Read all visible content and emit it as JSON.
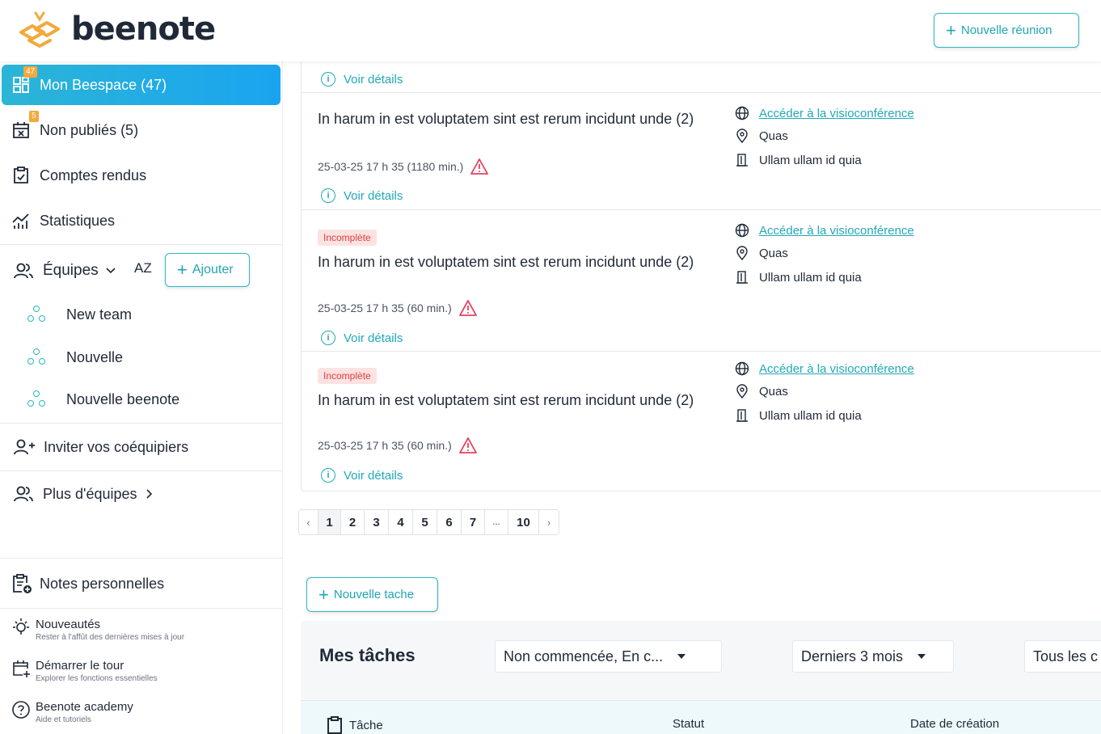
{
  "header": {
    "logo_text": "beenote",
    "new_meeting_label": "Nouvelle réunion"
  },
  "sidebar": {
    "items": [
      {
        "label": "Mon Beespace (47)",
        "badge": "47",
        "active": true
      },
      {
        "label": "Non publiés (5)",
        "badge": "5"
      },
      {
        "label": "Comptes rendus"
      },
      {
        "label": "Statistiques"
      }
    ],
    "teams": {
      "label": "Équipes",
      "sort_label": "AZ",
      "add_label": "Ajouter",
      "list": [
        "New team",
        "Nouvelle",
        "Nouvelle beenote"
      ]
    },
    "invite_label": "Inviter vos coéquipiers",
    "more_teams_label": "Plus d'équipes",
    "notes_label": "Notes personnelles",
    "bottom": [
      {
        "title": "Nouveautés",
        "sub": "Rester à l'affût des dernières mises à jour"
      },
      {
        "title": "Démarrer le tour",
        "sub": "Explorer les fonctions essentielles"
      },
      {
        "title": "Beenote academy",
        "sub": "Aide et tutoriels"
      }
    ]
  },
  "meetings": {
    "details_label": "Voir détails",
    "list": [
      {
        "title": "In harum in est voluptatem sint est rerum incidunt unde (2)",
        "date": "25-03-25 17 h 35 (1180 min.)",
        "tag": "",
        "visio_label": "Accéder à la visioconférence",
        "location": "Quas",
        "room": "Ullam ullam id quia"
      },
      {
        "title": "In harum in est voluptatem sint est rerum incidunt unde (2)",
        "date": "25-03-25 17 h 35 (60 min.)",
        "tag": "Incomplète",
        "visio_label": "Accéder à la visioconférence",
        "location": "Quas",
        "room": "Ullam ullam id quia"
      },
      {
        "title": "In harum in est voluptatem sint est rerum incidunt unde (2)",
        "date": "25-03-25 17 h 35 (60 min.)",
        "tag": "Incomplète",
        "visio_label": "Accéder à la visioconférence",
        "location": "Quas",
        "room": "Ullam ullam id quia"
      }
    ]
  },
  "pagination": {
    "prev": "‹",
    "pages": [
      "1",
      "2",
      "3",
      "4",
      "5",
      "6",
      "7",
      "...",
      "10"
    ],
    "current": "1",
    "next": "›"
  },
  "tasks": {
    "new_task_label": "Nouvelle tache",
    "title": "Mes tâches",
    "filter_status": "Non commencée, En c...",
    "filter_period": "Derniers 3 mois",
    "filter_other": "Tous les c",
    "columns": [
      "Tâche",
      "Statut",
      "Date de création"
    ]
  },
  "colors": {
    "accent": "#21a9b7",
    "active_gradient_start": "#2bb5d6",
    "active_gradient_end": "#1aa4f0",
    "badge": "#f2a93b",
    "warning": "#e5405e"
  }
}
